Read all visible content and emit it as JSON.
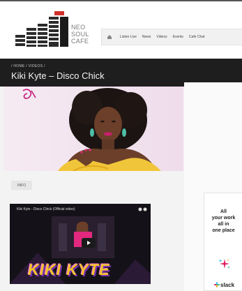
{
  "logo": {
    "line1": "NEO",
    "line2": "SOUL",
    "line3": "CAFE"
  },
  "nav": {
    "items": [
      "Listen Live",
      "News",
      "Videos",
      "Events",
      "Cafe Chat"
    ]
  },
  "breadcrumb": {
    "text": "/ HOME /  VIDEOS  /"
  },
  "page": {
    "title": "Kiki Kyte – Disco Chick"
  },
  "tabs": {
    "info": "INFO"
  },
  "video": {
    "title": "Kiki Kyte - Disco Chick (Official video)",
    "overlay_logo": "KIKI KYTE"
  },
  "ad": {
    "headline_lines": [
      "All",
      "your work",
      "all in",
      "one place"
    ],
    "brand": "slack"
  },
  "colors": {
    "header_band": "#1e1e1e",
    "logo_red": "#d0312d",
    "nav_bg": "#f1f1f1"
  }
}
